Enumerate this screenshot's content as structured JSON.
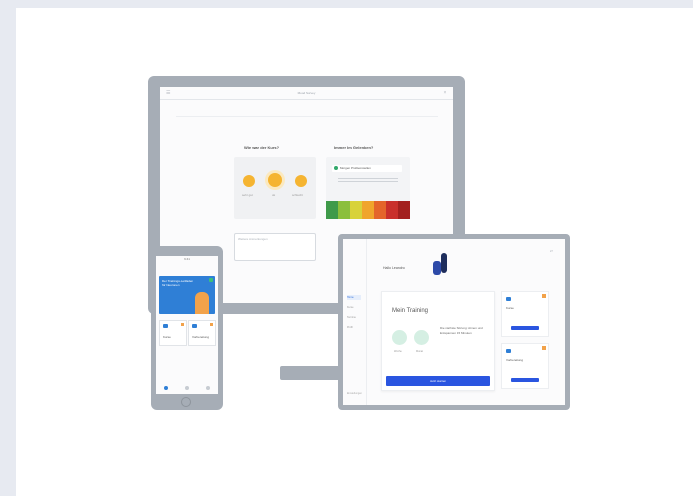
{
  "monitor": {
    "window_title": "Mood Survey",
    "question_mood": "Wie war der Kurs?",
    "question_wellbeing": "Immer Im Gelenken?",
    "mood_labels": [
      "sehr gut",
      "ok",
      "schlecht"
    ],
    "wellbeing_check": "Morgen Problemstellen",
    "comment_placeholder": "Weitere Anmerkungen",
    "scale_colors": [
      "#3f9a4a",
      "#8bbf3c",
      "#d8d23a",
      "#f0a52c",
      "#e4652b",
      "#c9302c",
      "#a3201f"
    ]
  },
  "phone": {
    "status_time": "9:41",
    "banner_text": "Der Trainings-Leitfaden für Neuronen",
    "tile_left_label": "Kurse",
    "tile_right_label": "Vorbereitung",
    "nav_items": [
      "home",
      "search",
      "profile"
    ]
  },
  "tablet": {
    "greeting": "Hallo Leandro",
    "avatar_label": "LT",
    "sidebar_items": [
      "Home",
      "Kurse",
      "Termine",
      "Profil"
    ],
    "sidebar_footer": "Einstellungen",
    "card_title": "Mein Training",
    "circle_labels": [
      "Woche",
      "Monat"
    ],
    "card_note": "Die nächste Sitzung: Atmen und Entspannen 15 Minuten",
    "card_button": "Jetzt starten",
    "mini_cards": [
      {
        "label": "Kurse"
      },
      {
        "label": "Vorbereitung"
      }
    ]
  },
  "colors": {
    "device_frame": "#a6adb6",
    "accent_blue": "#2a55e0",
    "banner_blue": "#2f7fd6",
    "emoji_yellow": "#f5b431",
    "tag_orange": "#f2a24a"
  }
}
